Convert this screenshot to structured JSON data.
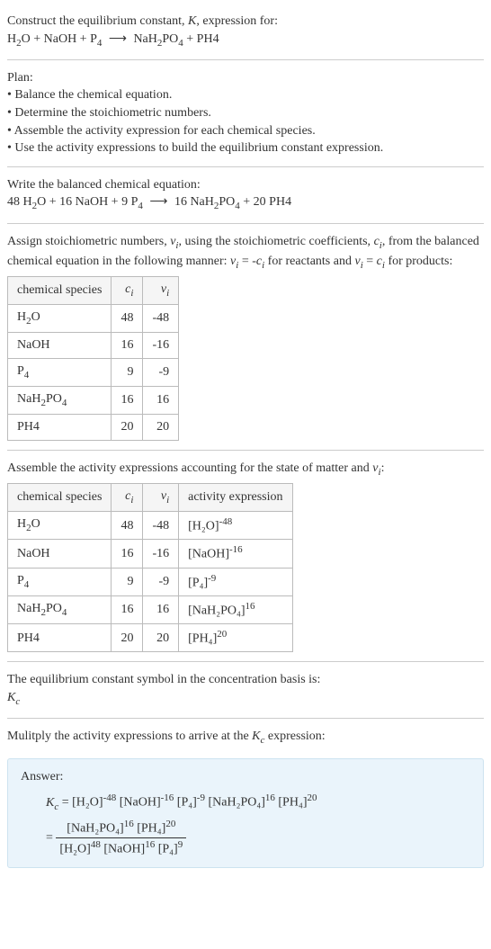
{
  "header": {
    "line1": "Construct the equilibrium constant, K, expression for:",
    "reaction_unbalanced": "H₂O + NaOH + P₄ ⟶ NaH₂PO₄ + PH4"
  },
  "plan": {
    "title": "Plan:",
    "items": [
      "• Balance the chemical equation.",
      "• Determine the stoichiometric numbers.",
      "• Assemble the activity expression for each chemical species.",
      "• Use the activity expressions to build the equilibrium constant expression."
    ]
  },
  "balanced": {
    "title": "Write the balanced chemical equation:",
    "reaction": "48 H₂O + 16 NaOH + 9 P₄ ⟶ 16 NaH₂PO₄ + 20 PH4"
  },
  "stoich_intro": "Assign stoichiometric numbers, νᵢ, using the stoichiometric coefficients, cᵢ, from the balanced chemical equation in the following manner: νᵢ = -cᵢ for reactants and νᵢ = cᵢ for products:",
  "table1": {
    "headers": [
      "chemical species",
      "cᵢ",
      "νᵢ"
    ],
    "rows": [
      {
        "species": "H₂O",
        "ci": "48",
        "vi": "-48"
      },
      {
        "species": "NaOH",
        "ci": "16",
        "vi": "-16"
      },
      {
        "species": "P₄",
        "ci": "9",
        "vi": "-9"
      },
      {
        "species": "NaH₂PO₄",
        "ci": "16",
        "vi": "16"
      },
      {
        "species": "PH4",
        "ci": "20",
        "vi": "20"
      }
    ]
  },
  "activity_intro": "Assemble the activity expressions accounting for the state of matter and νᵢ:",
  "table2": {
    "headers": [
      "chemical species",
      "cᵢ",
      "νᵢ",
      "activity expression"
    ],
    "rows": [
      {
        "species": "H₂O",
        "ci": "48",
        "vi": "-48",
        "act_base": "[H₂O]",
        "act_exp": "-48"
      },
      {
        "species": "NaOH",
        "ci": "16",
        "vi": "-16",
        "act_base": "[NaOH]",
        "act_exp": "-16"
      },
      {
        "species": "P₄",
        "ci": "9",
        "vi": "-9",
        "act_base": "[P₄]",
        "act_exp": "-9"
      },
      {
        "species": "NaH₂PO₄",
        "ci": "16",
        "vi": "16",
        "act_base": "[NaH₂PO₄]",
        "act_exp": "16"
      },
      {
        "species": "PH4",
        "ci": "20",
        "vi": "20",
        "act_base": "[PH₄]",
        "act_exp": "20"
      }
    ]
  },
  "symbol_intro": "The equilibrium constant symbol in the concentration basis is:",
  "symbol": "K_c",
  "multiply_intro": "Mulitply the activity expressions to arrive at the K_c expression:",
  "answer": {
    "label": "Answer:",
    "line1_lhs": "K_c",
    "line1_terms": [
      {
        "base": "[H₂O]",
        "exp": "-48"
      },
      {
        "base": "[NaOH]",
        "exp": "-16"
      },
      {
        "base": "[P₄]",
        "exp": "-9"
      },
      {
        "base": "[NaH₂PO₄]",
        "exp": "16"
      },
      {
        "base": "[PH₄]",
        "exp": "20"
      }
    ],
    "frac_num": [
      {
        "base": "[NaH₂PO₄]",
        "exp": "16"
      },
      {
        "base": "[PH₄]",
        "exp": "20"
      }
    ],
    "frac_den": [
      {
        "base": "[H₂O]",
        "exp": "48"
      },
      {
        "base": "[NaOH]",
        "exp": "16"
      },
      {
        "base": "[P₄]",
        "exp": "9"
      }
    ]
  },
  "chart_data": {
    "type": "table",
    "title": "Stoichiometric and activity data",
    "stoichiometric_table": {
      "columns": [
        "chemical species",
        "c_i",
        "ν_i"
      ],
      "rows": [
        [
          "H2O",
          48,
          -48
        ],
        [
          "NaOH",
          16,
          -16
        ],
        [
          "P4",
          9,
          -9
        ],
        [
          "NaH2PO4",
          16,
          16
        ],
        [
          "PH4",
          20,
          20
        ]
      ]
    },
    "activity_table": {
      "columns": [
        "chemical species",
        "c_i",
        "ν_i",
        "activity expression"
      ],
      "rows": [
        [
          "H2O",
          48,
          -48,
          "[H2O]^-48"
        ],
        [
          "NaOH",
          16,
          -16,
          "[NaOH]^-16"
        ],
        [
          "P4",
          9,
          -9,
          "[P4]^-9"
        ],
        [
          "NaH2PO4",
          16,
          16,
          "[NaH2PO4]^16"
        ],
        [
          "PH4",
          20,
          20,
          "[PH4]^20"
        ]
      ]
    }
  }
}
